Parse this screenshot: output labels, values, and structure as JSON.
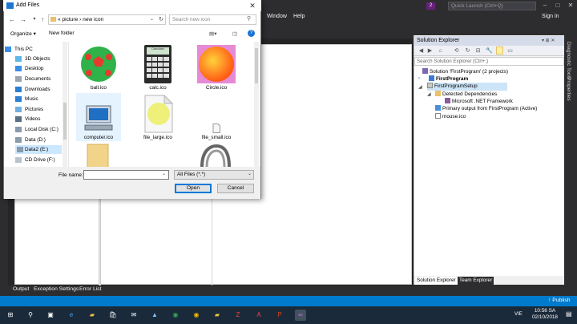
{
  "vs": {
    "menu": [
      "Window",
      "Help"
    ],
    "quick_launch": "Quick Launch (Ctrl+Q)",
    "notification_count": "2",
    "sign_in": "Sign in",
    "bottom_tabs": [
      "Output",
      "Exception Settings",
      "Error List"
    ],
    "publish": "↑ Publish"
  },
  "solution_explorer": {
    "title": "Solution Explorer",
    "search_placeholder": "Search Solution Explorer (Ctrl+;)",
    "tree": [
      "Solution 'FirstProgram' (2 projects)",
      "FirstProgram",
      "FirstProgramSetup",
      "Detected Dependencies",
      "Microsoft .NET Framework",
      "Primary output from FirstProgram (Active)",
      "mouse.ico"
    ],
    "tabs": [
      "Solution Explorer",
      "Team Explorer"
    ],
    "side_tabs": [
      "Diagnostic Tools",
      "Properties"
    ]
  },
  "dialog": {
    "title": "Add Files",
    "address": "« picture › new icon",
    "search_placeholder": "Search new icon",
    "organize": "Organize ▾",
    "new_folder": "New folder",
    "nav_items": [
      "This PC",
      "3D Objects",
      "Desktop",
      "Documents",
      "Downloads",
      "Music",
      "Pictures",
      "Videos",
      "Local Disk (C:)",
      "Data (D:)",
      "Data2 (E:)",
      "CD Drive (F:)"
    ],
    "files": [
      "ball.ico",
      "calc.ico",
      "Circle.ico",
      "computer.ico",
      "file_large.ico",
      "file_small.ico"
    ],
    "calc_screen_text": "Calculator",
    "file_name_label": "File name:",
    "file_name_value": "",
    "filter": "All Files (*.*)",
    "open": "Open",
    "cancel": "Cancel"
  },
  "taskbar": {
    "time": "10:56 SA",
    "date": "02/10/2018",
    "lang": "VIE"
  }
}
